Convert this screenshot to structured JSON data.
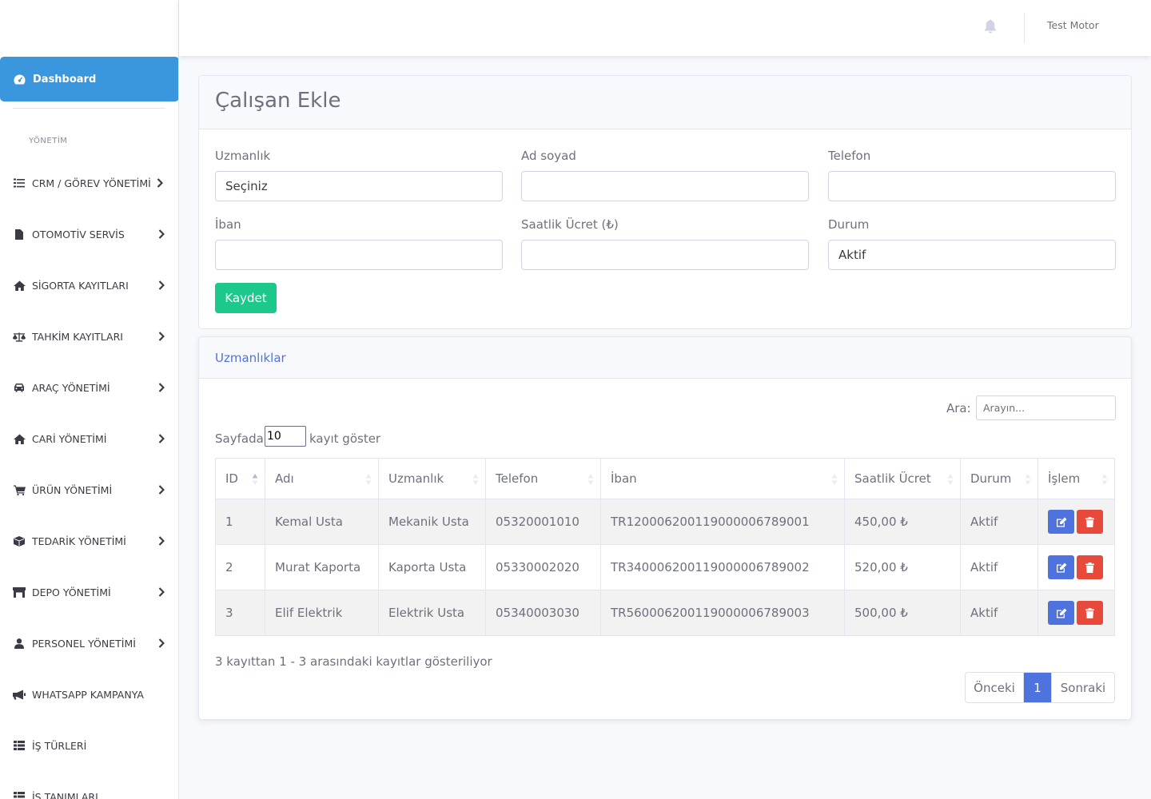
{
  "sidebar": {
    "dashboard_label": "Dashboard",
    "heading": "YÖNETİM",
    "items": [
      {
        "label": "CRM / GÖREV YÖNETİMİ",
        "icon": "tasks-icon"
      },
      {
        "label": "OTOMOTİV SERVİS",
        "icon": "file-icon"
      },
      {
        "label": "SİGORTA KAYITLARI",
        "icon": "home-icon"
      },
      {
        "label": "TAHKİM KAYITLARI",
        "icon": "balance-scale-icon"
      },
      {
        "label": "ARAÇ YÖNETİMİ",
        "icon": "car-icon"
      },
      {
        "label": "CARİ YÖNETİMİ",
        "icon": "home-icon"
      },
      {
        "label": "ÜRÜN YÖNETİMİ",
        "icon": "cart-icon"
      },
      {
        "label": "TEDARİK YÖNETİMİ",
        "icon": "box-icon"
      },
      {
        "label": "DEPO YÖNETİMİ",
        "icon": "warehouse-icon"
      },
      {
        "label": "PERSONEL YÖNETİMİ",
        "icon": "user-icon"
      },
      {
        "label": "WHATSAPP KAMPANYA",
        "icon": "megaphone-icon"
      },
      {
        "label": "İŞ TÜRLERİ",
        "icon": "table-icon"
      },
      {
        "label": "İŞ TANIMLARI",
        "icon": "table-icon"
      }
    ]
  },
  "topbar": {
    "user_name": "Test Motor"
  },
  "form": {
    "title": "Çalışan Ekle",
    "uzmanlik_label": "Uzmanlık",
    "uzmanlik_value": "Seçiniz",
    "adsoyad_label": "Ad soyad",
    "telefon_label": "Telefon",
    "iban_label": "İban",
    "saatlik_label": "Saatlik Ücret (₺)",
    "durum_label": "Durum",
    "durum_value": "Aktif",
    "save_label": "Kaydet"
  },
  "list": {
    "title": "Uzmanlıklar",
    "search_label": "Ara:",
    "search_placeholder": "Arayın...",
    "length_prefix": "Sayfada",
    "length_value": "10",
    "length_suffix": "kayıt göster",
    "columns": [
      "ID",
      "Adı",
      "Uzmanlık",
      "Telefon",
      "İban",
      "Saatlik Ücret",
      "Durum",
      "İşlem"
    ],
    "rows": [
      {
        "id": "1",
        "name": "Kemal Usta",
        "specialty": "Mekanik Usta",
        "phone": "05320001010",
        "iban": "TR120006200119000006789001",
        "rate": "450,00 ₺",
        "status": "Aktif"
      },
      {
        "id": "2",
        "name": "Murat Kaporta",
        "specialty": "Kaporta Usta",
        "phone": "05330002020",
        "iban": "TR340006200119000006789002",
        "rate": "520,00 ₺",
        "status": "Aktif"
      },
      {
        "id": "3",
        "name": "Elif Elektrik",
        "specialty": "Elektrik Usta",
        "phone": "05340003030",
        "iban": "TR560006200119000006789003",
        "rate": "500,00 ₺",
        "status": "Aktif"
      }
    ],
    "info": "3 kayıttan 1 - 3 arasındaki kayıtlar gösteriliyor",
    "pager": {
      "prev": "Önceki",
      "current": "1",
      "next": "Sonraki"
    }
  }
}
